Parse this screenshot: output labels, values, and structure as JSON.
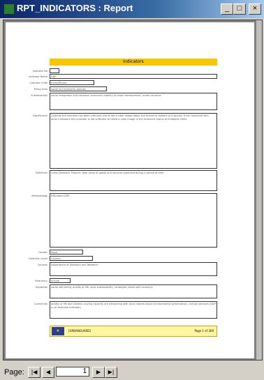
{
  "window": {
    "title": "RPT_INDICATORS : Report",
    "min_glyph": "_",
    "max_glyph": "□",
    "close_glyph": "×",
    "icon": "report-icon"
  },
  "report": {
    "header": "Indicators",
    "fields": [
      {
        "label": "Indicator No",
        "value": ""
      },
      {
        "label": "Indicator Name",
        "value": "GDP"
      },
      {
        "label": "Indicator Units",
        "value": "Euros/Person"
      },
      {
        "label": "Policy Area",
        "value": "social and economic policies"
      },
      {
        "label": "Sustainability",
        "value": "social integration and cohesion, economic viability of urban development, urban cohesion"
      },
      {
        "label": "Significance",
        "value": "Quantify the indicator has been criticised due to not a clear image about the economic welfare of a society. If not combined with other indicators this indicator is not sufficient to throw a clear image of the economic status of European cities."
      },
      {
        "label": "Definition",
        "value": "Gross Domestic Product: Total value of goods and services produced during a period of time."
      },
      {
        "label": "Methodology",
        "value": "Estimated GDP"
      },
      {
        "label": "Gender",
        "value": "None"
      },
      {
        "label": "Collection Level",
        "value": "Country"
      },
      {
        "label": "Sources",
        "value": "Department of Statistics and Research"
      },
      {
        "label": "Frequency",
        "value": "Annual"
      },
      {
        "label": "Keywords",
        "value": "social well being, quality of life, local sustainability, strategies linked with economy"
      },
      {
        "label": "Comments",
        "value": "quality of life and citizens: buying capacity are interacting with local choices about environmental preservation, cultural services (GDP is an essential indicator)"
      }
    ],
    "footer_code": "[URBANGUARD]",
    "footer_page": "Page 1 of 309"
  },
  "nav": {
    "page_label": "Page:",
    "current_page": "1",
    "first_glyph": "|◀",
    "prev_glyph": "◀",
    "next_glyph": "▶",
    "last_glyph": "▶|"
  }
}
